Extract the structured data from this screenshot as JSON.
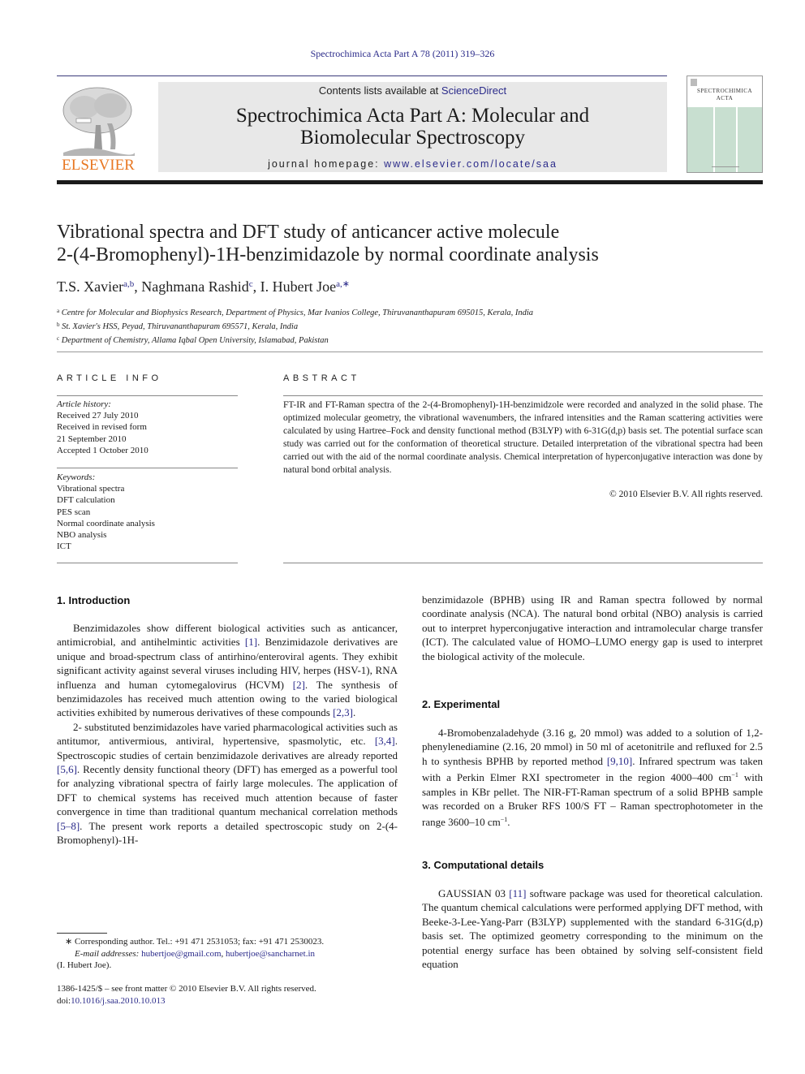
{
  "header": {
    "citation": "Spectrochimica Acta Part A 78 (2011) 319–326",
    "contents_prefix": "Contents lists available at ",
    "contents_link": "ScienceDirect",
    "journal_line1": "Spectrochimica Acta Part A: Molecular and",
    "journal_line2": "Biomolecular Spectroscopy",
    "homepage_prefix": "journal homepage: ",
    "homepage_link": "www.elsevier.com/locate/saa",
    "publisher_logo": "ELSEVIER",
    "cover_title_line1": "SPECTROCHIMICA",
    "cover_title_line2": "ACTA",
    "colors": {
      "link": "#2b2b8a",
      "elsevier_orange": "#e87722",
      "cover_green": "#c8dfd0",
      "banner_gray": "#e8e8e8"
    }
  },
  "article": {
    "title_line1": "Vibrational spectra and DFT study of anticancer active molecule",
    "title_line2": "2-(4-Bromophenyl)-1H-benzimidazole by normal coordinate analysis",
    "authors": [
      {
        "name": "T.S. Xavier",
        "sup": "a,b",
        "sep": ", "
      },
      {
        "name": "Naghmana Rashid",
        "sup": "c",
        "sep": ", "
      },
      {
        "name": "I. Hubert Joe",
        "sup": "a,∗",
        "sep": ""
      }
    ],
    "affiliations": [
      {
        "key": "a",
        "text": "Centre for Molecular and Biophysics Research, Department of Physics, Mar Ivanios College, Thiruvananthapuram 695015, Kerala, India"
      },
      {
        "key": "b",
        "text": "St. Xavier's HSS, Peyad, Thiruvananthapuram 695571, Kerala, India"
      },
      {
        "key": "c",
        "text": "Department of Chemistry, Allama Iqbal Open University, Islamabad, Pakistan"
      }
    ]
  },
  "article_info": {
    "heading": "ARTICLE INFO",
    "history_label": "Article history:",
    "history": [
      "Received 27 July 2010",
      "Received in revised form",
      "21 September 2010",
      "Accepted 1 October 2010"
    ],
    "keywords_label": "Keywords:",
    "keywords": [
      "Vibrational spectra",
      "DFT calculation",
      "PES scan",
      "Normal coordinate analysis",
      "NBO analysis",
      "ICT"
    ]
  },
  "abstract": {
    "heading": "ABSTRACT",
    "text": "FT-IR and FT-Raman spectra of the 2-(4-Bromophenyl)-1H-benzimidzole were recorded and analyzed in the solid phase. The optimized molecular geometry, the vibrational wavenumbers, the infrared intensities and the Raman scattering activities were calculated by using Hartree–Fock and density functional method (B3LYP) with 6-31G(d,p) basis set. The potential surface scan study was carried out for the conformation of theoretical structure. Detailed interpretation of the vibrational spectra had been carried out with the aid of the normal coordinate analysis. Chemical interpretation of hyperconjugative interaction was done by natural bond orbital analysis.",
    "copyright": "© 2010 Elsevier B.V. All rights reserved."
  },
  "sections": {
    "intro": {
      "heading": "1.  Introduction",
      "p1": [
        "Benzimidazoles show different biological activities such as anticancer, antimicrobial, and antihelmintic activities ",
        "[1]",
        ". Benzimidazole derivatives are unique and broad-spectrum class of antirhino/enteroviral agents. They exhibit significant activity against several viruses including HIV, herpes (HSV-1), RNA influenza and human cytomegalovirus (HCVM) ",
        "[2]",
        ". The synthesis of benzimidazoles has received much attention owing to the varied biological activities exhibited by numerous derivatives of these compounds ",
        "[2,3]",
        "."
      ],
      "p2": [
        "2- substituted benzimidazoles have varied pharmacological activities such as antitumor, antivermious, antiviral, hypertensive, spasmolytic, etc. ",
        "[3,4]",
        ". Spectroscopic studies of certain benzimidazole derivatives are already reported ",
        "[5,6]",
        ". Recently density functional theory (DFT) has emerged as a powerful tool for analyzing vibrational spectra of fairly large molecules. The application of DFT to chemical systems has received much attention because of faster convergence in time than traditional quantum mechanical correlation methods ",
        "[5–8]",
        ". The present work reports a detailed spectroscopic study on 2-(4-Bromophenyl)-1H-"
      ],
      "p3": "benzimidazole (BPHB) using IR and Raman spectra followed by normal coordinate analysis (NCA). The natural bond orbital (NBO) analysis is carried out to interpret hyperconjugative interaction and intramolecular charge transfer (ICT). The calculated value of HOMO–LUMO energy gap is used to interpret the biological activity of the molecule."
    },
    "experimental": {
      "heading": "2.  Experimental",
      "p1": [
        "4-Bromobenzaladehyde (3.16 g, 20 mmol) was added to a solution of 1,2-phenylenediamine (2.16, 20 mmol) in 50 ml of acetonitrile and refluxed for 2.5 h to synthesis BPHB by reported method ",
        "[9,10]",
        ". Infrared spectrum was taken with a Perkin Elmer RXI spectrometer in the region 4000–400 cm",
        "−1",
        " with samples in KBr pellet. The NIR-FT-Raman spectrum of a solid BPHB sample was recorded on a Bruker RFS 100/S FT – Raman spectrophotometer in the range 3600–10 cm",
        "−1",
        "."
      ]
    },
    "computational": {
      "heading": "3.  Computational details",
      "p1": [
        "GAUSSIAN 03 ",
        "[11]",
        " software package was used for theoretical calculation. The quantum chemical calculations were performed applying DFT method, with Beeke-3-Lee-Yang-Parr (B3LYP) supplemented with the standard 6-31G(d,p) basis set. The optimized geometry corresponding to the minimum on the potential energy surface has been obtained by solving self-consistent field equation"
      ]
    }
  },
  "footnote": {
    "corresponding": "∗ Corresponding author. Tel.: +91 471 2531053; fax: +91 471 2530023.",
    "email_label": "E-mail addresses: ",
    "email1": "hubertjoe@gmail.com",
    "email_sep": ", ",
    "email2": "hubertjoe@sancharnet.in",
    "name": "(I. Hubert Joe).",
    "front_matter": "1386-1425/$ – see front matter © 2010 Elsevier B.V. All rights reserved.",
    "doi_label": "doi:",
    "doi": "10.1016/j.saa.2010.10.013"
  }
}
